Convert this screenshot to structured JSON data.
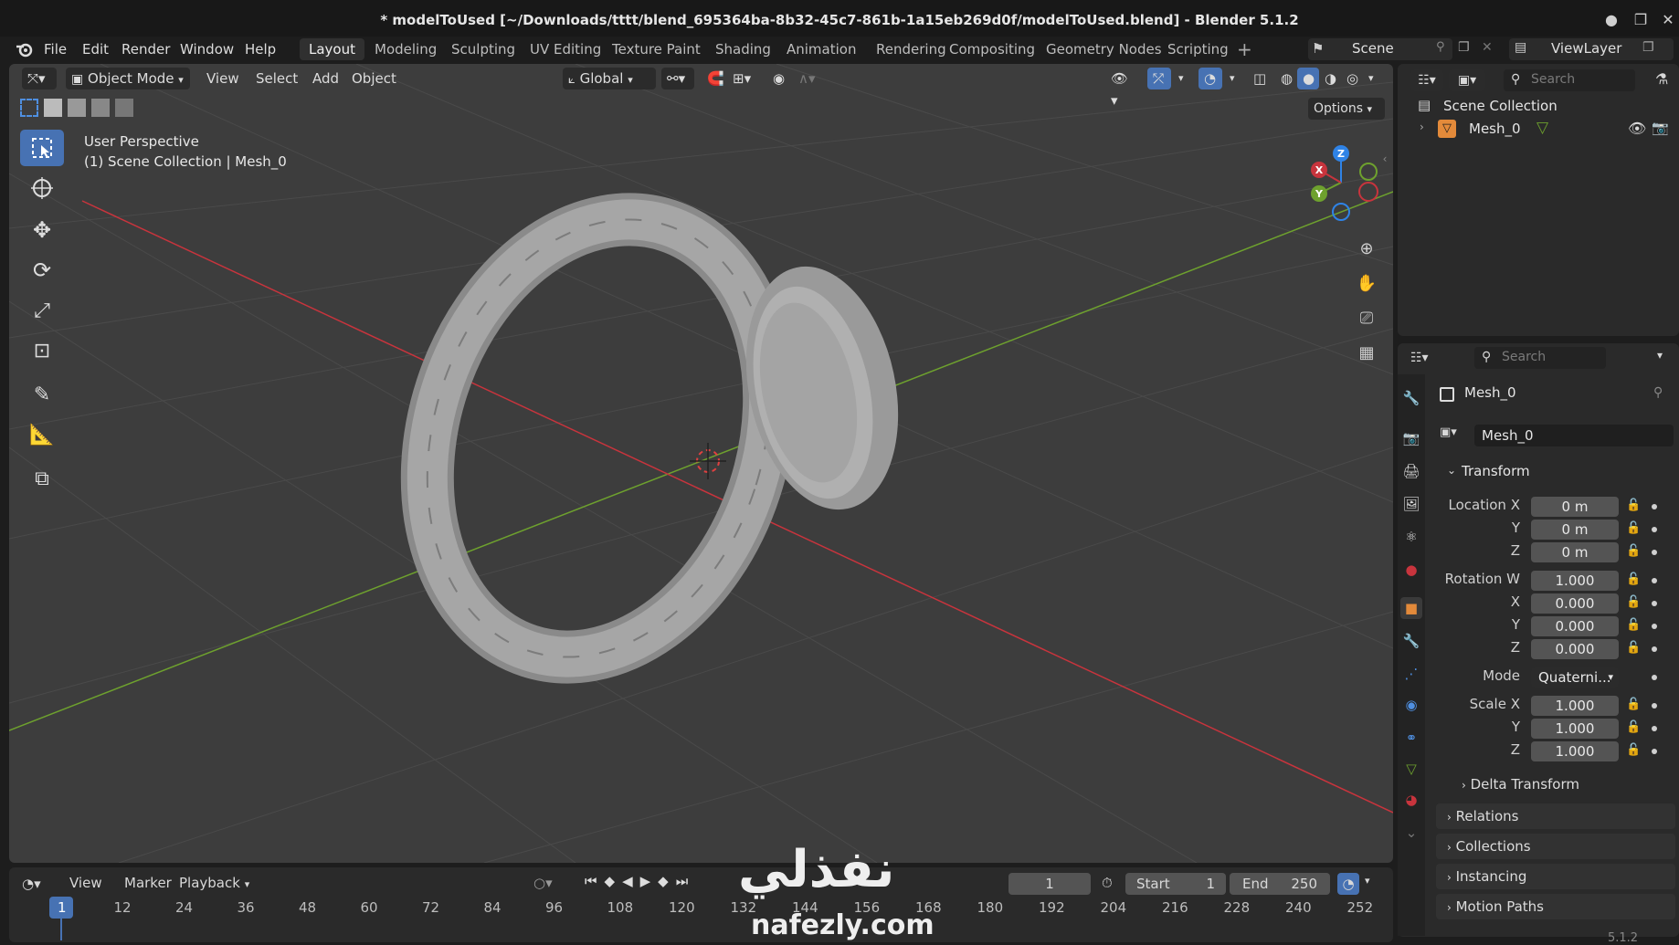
{
  "window": {
    "title": "* modelToUsed [~/Downloads/tttt/blend_695364ba-8b32-45c7-861b-1a15eb269d0f/modelToUsed.blend] - Blender 5.1.2"
  },
  "menu": [
    "File",
    "Edit",
    "Render",
    "Window",
    "Help"
  ],
  "workspaces": [
    "Layout",
    "Modeling",
    "Sculpting",
    "UV Editing",
    "Texture Paint",
    "Shading",
    "Animation",
    "Rendering",
    "Compositing",
    "Geometry Nodes",
    "Scripting"
  ],
  "scene": {
    "label": "Scene",
    "viewlayer": "ViewLayer"
  },
  "viewport": {
    "mode": "Object Mode",
    "menus": [
      "View",
      "Select",
      "Add",
      "Object"
    ],
    "orientation": "Global",
    "options": "Options",
    "overlay_line1": "User Perspective",
    "overlay_line2": "(1) Scene Collection | Mesh_0",
    "gizmo": {
      "x": "X",
      "y": "Y",
      "z": "Z"
    }
  },
  "outliner": {
    "search_placeholder": "Search",
    "collection": "Scene Collection",
    "object": "Mesh_0"
  },
  "properties": {
    "search_placeholder": "Search",
    "object_name": "Mesh_0",
    "datablock": "Mesh_0",
    "transform_title": "Transform",
    "location": {
      "label": "Location X",
      "x": "0 m",
      "y": "0 m",
      "z": "0 m"
    },
    "rotation": {
      "label": "Rotation W",
      "w": "1.000",
      "x": "0.000",
      "y": "0.000",
      "z": "0.000"
    },
    "mode_label": "Mode",
    "mode_value": "Quaterni...",
    "scale": {
      "label": "Scale X",
      "x": "1.000",
      "y": "1.000",
      "z": "1.000"
    },
    "axis_y": "Y",
    "axis_z": "Z",
    "axis_x": "X",
    "sections": [
      "Delta Transform",
      "Relations",
      "Collections",
      "Instancing",
      "Motion Paths"
    ]
  },
  "timeline": {
    "menus": [
      "View",
      "Marker",
      "Playback"
    ],
    "current_frame": "1",
    "start_label": "Start",
    "start": "1",
    "end_label": "End",
    "end": "250",
    "ticks": [
      "1",
      "12",
      "24",
      "36",
      "48",
      "60",
      "72",
      "84",
      "96",
      "108",
      "120",
      "132",
      "144",
      "156",
      "168",
      "180",
      "192",
      "204",
      "216",
      "228",
      "240",
      "252"
    ]
  },
  "watermark": {
    "arabic": "نفذلي",
    "url": "nafezly.com"
  },
  "version": "5.1.2",
  "colors": {
    "accent": "#4772b3",
    "x_axis": "#c8343d",
    "y_axis": "#6ea12e",
    "z_axis": "#2f83e6",
    "viewport": "#3d3d3d"
  }
}
